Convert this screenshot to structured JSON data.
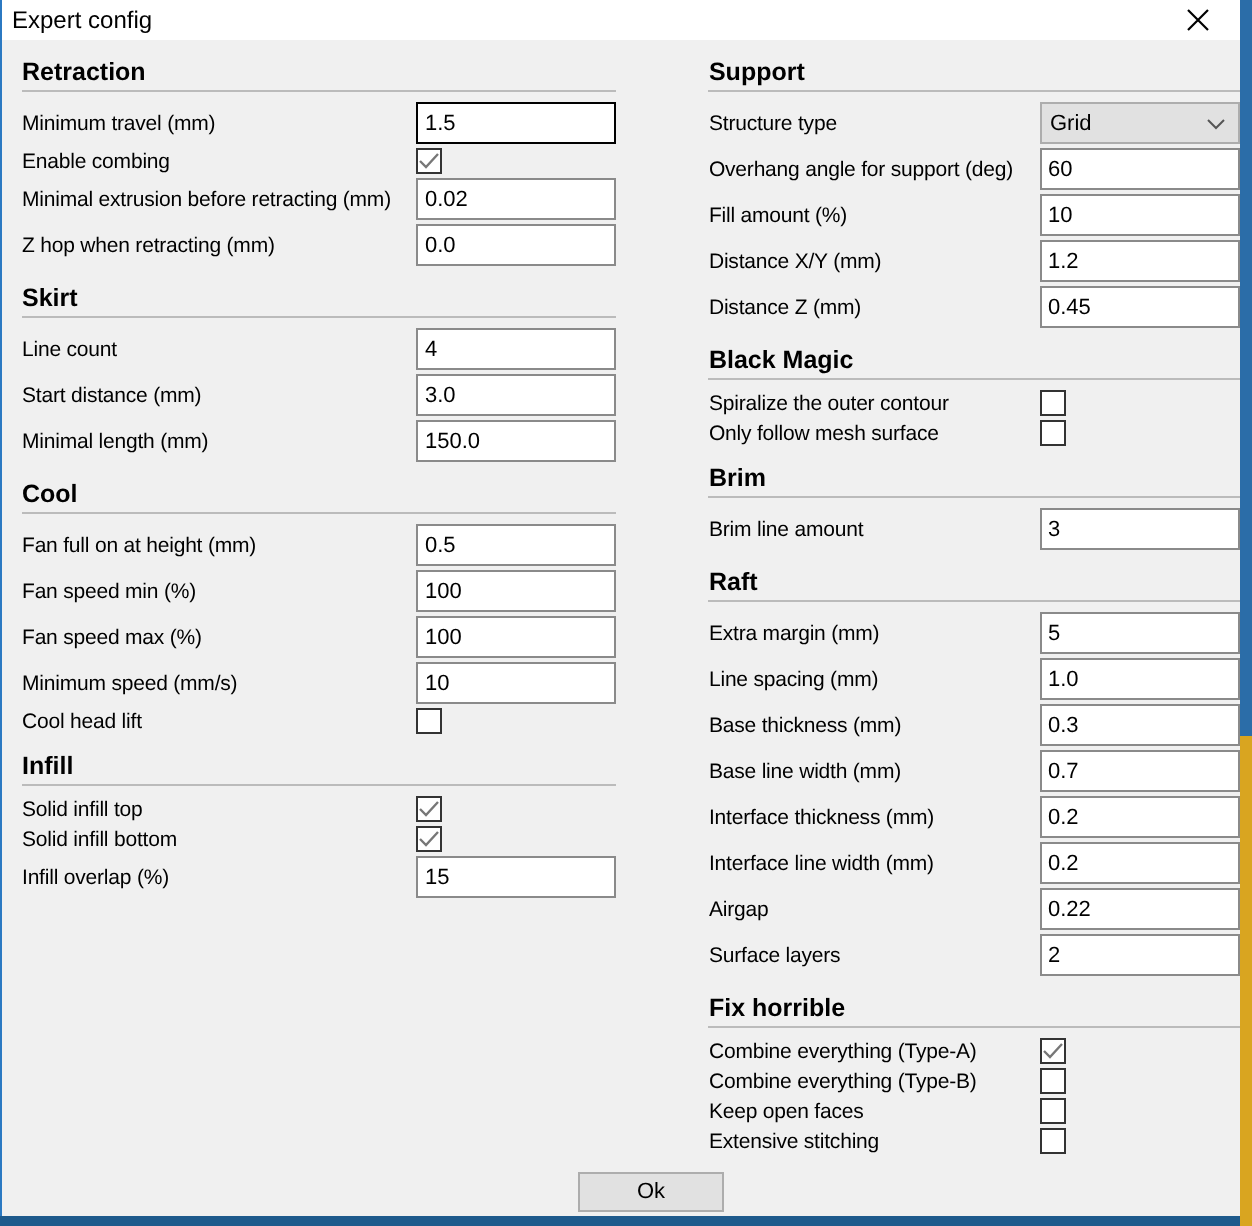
{
  "window": {
    "title": "Expert config"
  },
  "columns": [
    {
      "sections": [
        {
          "title": "Retraction",
          "rows": [
            {
              "kind": "field",
              "label": "Minimum travel (mm)",
              "value": "1.5",
              "focused": true
            },
            {
              "kind": "check",
              "label": "Enable combing",
              "checked": true
            },
            {
              "kind": "field",
              "label": "Minimal extrusion before retracting (mm)",
              "value": "0.02",
              "focused": false
            },
            {
              "kind": "field",
              "label": "Z hop when retracting (mm)",
              "value": "0.0",
              "focused": false
            }
          ]
        },
        {
          "title": "Skirt",
          "rows": [
            {
              "kind": "field",
              "label": "Line count",
              "value": "4",
              "focused": false
            },
            {
              "kind": "field",
              "label": "Start distance (mm)",
              "value": "3.0",
              "focused": false
            },
            {
              "kind": "field",
              "label": "Minimal length (mm)",
              "value": "150.0",
              "focused": false
            }
          ]
        },
        {
          "title": "Cool",
          "rows": [
            {
              "kind": "field",
              "label": "Fan full on at height (mm)",
              "value": "0.5",
              "focused": false
            },
            {
              "kind": "field",
              "label": "Fan speed min (%)",
              "value": "100",
              "focused": false
            },
            {
              "kind": "field",
              "label": "Fan speed max (%)",
              "value": "100",
              "focused": false
            },
            {
              "kind": "field",
              "label": "Minimum speed (mm/s)",
              "value": "10",
              "focused": false
            },
            {
              "kind": "check",
              "label": "Cool head lift",
              "checked": false
            }
          ]
        },
        {
          "title": "Infill",
          "rows": [
            {
              "kind": "check",
              "label": "Solid infill top",
              "checked": true
            },
            {
              "kind": "check",
              "label": "Solid infill bottom",
              "checked": true
            },
            {
              "kind": "field",
              "label": "Infill overlap (%)",
              "value": "15",
              "focused": false
            }
          ]
        }
      ]
    },
    {
      "sections": [
        {
          "title": "Support",
          "rows": [
            {
              "kind": "select",
              "label": "Structure type",
              "value": "Grid"
            },
            {
              "kind": "field",
              "label": "Overhang angle for support (deg)",
              "value": "60",
              "focused": false
            },
            {
              "kind": "field",
              "label": "Fill amount (%)",
              "value": "10",
              "focused": false
            },
            {
              "kind": "field",
              "label": "Distance X/Y (mm)",
              "value": "1.2",
              "focused": false
            },
            {
              "kind": "field",
              "label": "Distance Z (mm)",
              "value": "0.45",
              "focused": false
            }
          ]
        },
        {
          "title": "Black Magic",
          "rows": [
            {
              "kind": "check",
              "label": "Spiralize the outer contour",
              "checked": false
            },
            {
              "kind": "check",
              "label": "Only follow mesh surface",
              "checked": false
            }
          ]
        },
        {
          "title": "Brim",
          "rows": [
            {
              "kind": "field",
              "label": "Brim line amount",
              "value": "3",
              "focused": false
            }
          ]
        },
        {
          "title": "Raft",
          "rows": [
            {
              "kind": "field",
              "label": "Extra margin (mm)",
              "value": "5",
              "focused": false
            },
            {
              "kind": "field",
              "label": "Line spacing (mm)",
              "value": "1.0",
              "focused": false
            },
            {
              "kind": "field",
              "label": "Base thickness (mm)",
              "value": "0.3",
              "focused": false
            },
            {
              "kind": "field",
              "label": "Base line width (mm)",
              "value": "0.7",
              "focused": false
            },
            {
              "kind": "field",
              "label": "Interface thickness (mm)",
              "value": "0.2",
              "focused": false
            },
            {
              "kind": "field",
              "label": "Interface line width (mm)",
              "value": "0.2",
              "focused": false
            },
            {
              "kind": "field",
              "label": "Airgap",
              "value": "0.22",
              "focused": false
            },
            {
              "kind": "field",
              "label": "Surface layers",
              "value": "2",
              "focused": false
            }
          ]
        },
        {
          "title": "Fix horrible",
          "rows": [
            {
              "kind": "check",
              "label": "Combine everything (Type-A)",
              "checked": true
            },
            {
              "kind": "check",
              "label": "Combine everything (Type-B)",
              "checked": false
            },
            {
              "kind": "check",
              "label": "Keep open faces",
              "checked": false
            },
            {
              "kind": "check",
              "label": "Extensive stitching",
              "checked": false
            }
          ]
        }
      ]
    }
  ],
  "buttons": [
    "Ok"
  ]
}
